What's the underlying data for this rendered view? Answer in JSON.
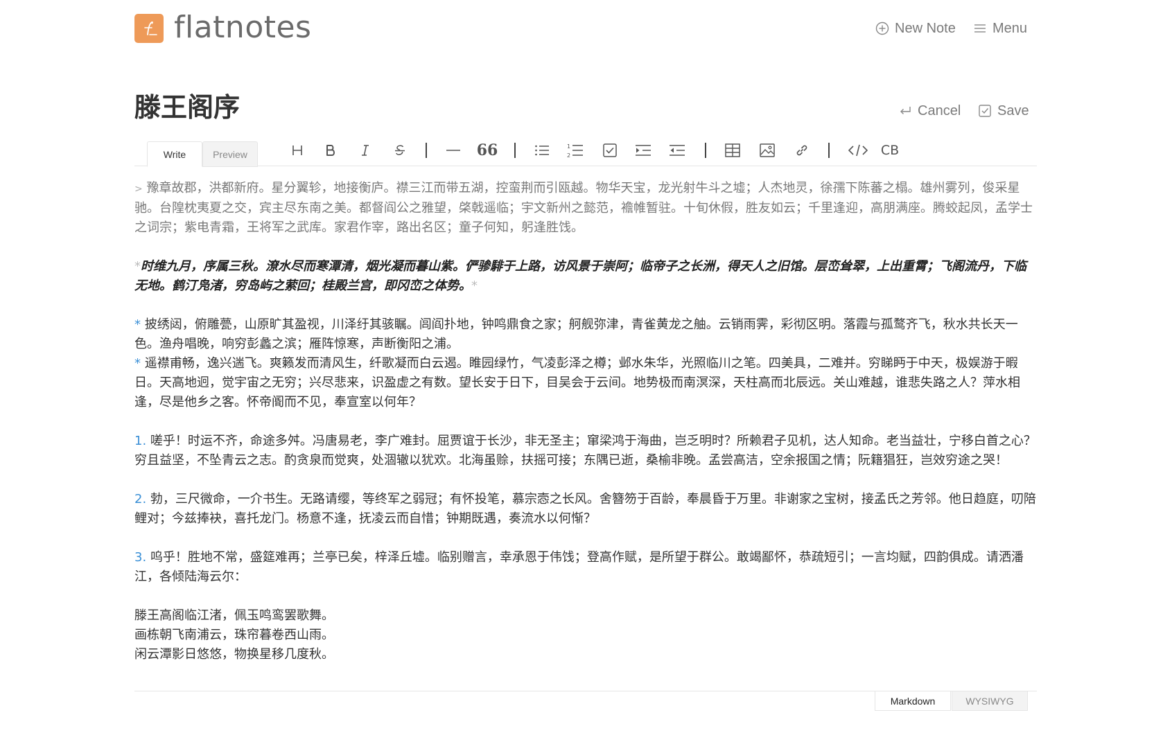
{
  "app": {
    "name": "flatnotes",
    "logo_glyph": "f_",
    "accent_color": "#ee9a58"
  },
  "nav": {
    "new_note_label": "New Note",
    "menu_label": "Menu"
  },
  "note": {
    "title": "滕王阁序",
    "cancel_label": "Cancel",
    "save_label": "Save"
  },
  "editor_tabs": {
    "write_label": "Write",
    "preview_label": "Preview"
  },
  "toolbar": {
    "icons": [
      "heading-icon",
      "bold-icon",
      "italic-icon",
      "strikethrough-icon",
      "horizontal-rule-icon",
      "quote-icon",
      "bullet-list-icon",
      "ordered-list-icon",
      "task-list-icon",
      "indent-icon",
      "outdent-icon",
      "table-icon",
      "image-icon",
      "link-icon",
      "code-icon",
      "codeblock-icon"
    ],
    "codeblock_label": "CB"
  },
  "content": {
    "quote_marker": ">",
    "quote_text": "豫章故郡，洪都新府。星分翼轸，地接衡庐。襟三江而带五湖，控蛮荆而引瓯越。物华天宝，龙光射牛斗之墟；人杰地灵，徐孺下陈蕃之榻。雄州雾列，俊采星驰。台隍枕夷夏之交，宾主尽东南之美。都督阎公之雅望，棨戟遥临；宇文新州之懿范，襜帷暂驻。十旬休假，胜友如云；千里逢迎，高朋满座。腾蛟起凤，孟学士之词宗；紫电青霜，王将军之武库。家君作宰，路出名区；童子何知，躬逢胜饯。",
    "italic_marker": "*",
    "italic_text": "时维九月，序属三秋。潦水尽而寒潭清，烟光凝而暮山紫。俨骖騑于上路，访风景于崇阿；临帝子之长洲，得天人之旧馆。层峦耸翠，上出重霄；飞阁流丹，下临无地。鹤汀凫渚，穷岛屿之萦回；桂殿兰宫，即冈峦之体势。",
    "bullet_marker": "*",
    "bullet_1": "披绣闼，俯雕甍，山原旷其盈视，川泽纡其骇瞩。闾阎扑地，钟鸣鼎食之家；舸舰弥津，青雀黄龙之舳。云销雨霁，彩彻区明。落霞与孤鹜齐飞，秋水共长天一色。渔舟唱晚，响穷彭蠡之滨；雁阵惊寒，声断衡阳之浦。",
    "bullet_2": "遥襟甫畅，逸兴遄飞。爽籁发而清风生，纤歌凝而白云遏。睢园绿竹，气凌彭泽之樽；邺水朱华，光照临川之笔。四美具，二难并。穷睇眄于中天，极娱游于暇日。天高地迥，觉宇宙之无穷；兴尽悲来，识盈虚之有数。望长安于日下，目吴会于云间。地势极而南溟深，天柱高而北辰远。关山难越，谁悲失路之人？萍水相逢，尽是他乡之客。怀帝阍而不见，奉宣室以何年？",
    "num_1_marker": "1.",
    "num_1": "嗟乎！时运不齐，命途多舛。冯唐易老，李广难封。屈贾谊于长沙，非无圣主；窜梁鸿于海曲，岂乏明时？所赖君子见机，达人知命。老当益壮，宁移白首之心？穷且益坚，不坠青云之志。酌贪泉而觉爽，处涸辙以犹欢。北海虽赊，扶摇可接；东隅已逝，桑榆非晚。孟尝高洁，空余报国之情；阮籍猖狂，岂效穷途之哭！",
    "num_2_marker": "2.",
    "num_2": "勃，三尺微命，一介书生。无路请缨，等终军之弱冠；有怀投笔，慕宗悫之长风。舍簪笏于百龄，奉晨昏于万里。非谢家之宝树，接孟氏之芳邻。他日趋庭，叨陪鲤对；今兹捧袂，喜托龙门。杨意不逢，抚凌云而自惜；钟期既遇，奏流水以何惭？",
    "num_3_marker": "3.",
    "num_3": "呜乎！胜地不常，盛筵难再；兰亭已矣，梓泽丘墟。临别赠言，幸承恩于伟饯；登高作赋，是所望于群公。敢竭鄙怀，恭疏短引；一言均赋，四韵俱成。请洒潘江，各倾陆海云尔：",
    "poem": [
      "滕王高阁临江渚，佩玉鸣鸾罢歌舞。",
      "画栋朝飞南浦云，珠帘暮卷西山雨。",
      "闲云潭影日悠悠，物换星移几度秋。"
    ]
  },
  "mode_tabs": {
    "markdown_label": "Markdown",
    "wysiwyg_label": "WYSIWYG"
  }
}
